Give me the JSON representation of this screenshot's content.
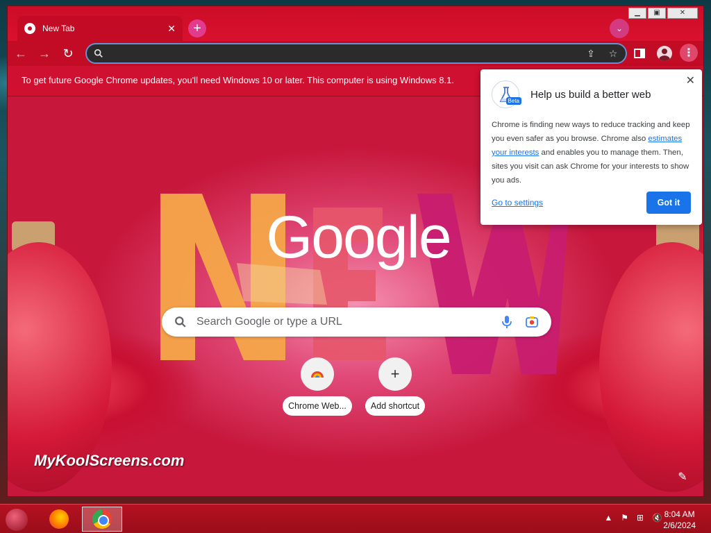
{
  "window": {
    "controls": {
      "minimize": "▁",
      "maximize": "▣",
      "close": "✕"
    }
  },
  "tab": {
    "title": "New Tab",
    "close": "✕"
  },
  "tabstrip": {
    "new_tab": "+",
    "tab_search": "⌄"
  },
  "toolbar": {
    "back": "←",
    "forward": "→",
    "reload": "↻",
    "share": "⇪",
    "bookmark": "☆",
    "side_panel": "▮",
    "menu": "⋮"
  },
  "omnibox": {
    "value": "",
    "placeholder": ""
  },
  "infobar": {
    "message": "To get future Google Chrome updates, you'll need Windows 10 or later. This computer is using Windows 8.1."
  },
  "ntp": {
    "logo": "Google",
    "search_placeholder": "Search Google or type a URL",
    "shortcuts": [
      {
        "label": "Chrome Web...",
        "icon": "chrome-web-store-icon",
        "glyph": "◓"
      },
      {
        "label": "Add shortcut",
        "icon": "add-icon",
        "glyph": "+"
      }
    ],
    "watermark": "MyKoolScreens.com",
    "customize": "✎"
  },
  "popup": {
    "title": "Help us build a better web",
    "badge": "Beta",
    "body_before": "Chrome is finding new ways to reduce tracking and keep you even safer as you browse. Chrome also ",
    "body_link": "estimates your interests",
    "body_after": " and enables you to manage them. Then, sites you visit can ask Chrome for your interests to show you ads.",
    "settings_link": "Go to settings",
    "button": "Got it",
    "close": "✕"
  },
  "taskbar": {
    "apps": [
      "firefox-icon",
      "chrome-icon"
    ],
    "tray": {
      "arrow": "▲",
      "flag": "⚑",
      "network": "⊞",
      "volume": "🔇"
    },
    "time": "8:04 AM",
    "date": "2/6/2024"
  },
  "colors": {
    "accent": "#1a73e8",
    "window_frame": "#d8102c",
    "infobar": "#d01030"
  }
}
